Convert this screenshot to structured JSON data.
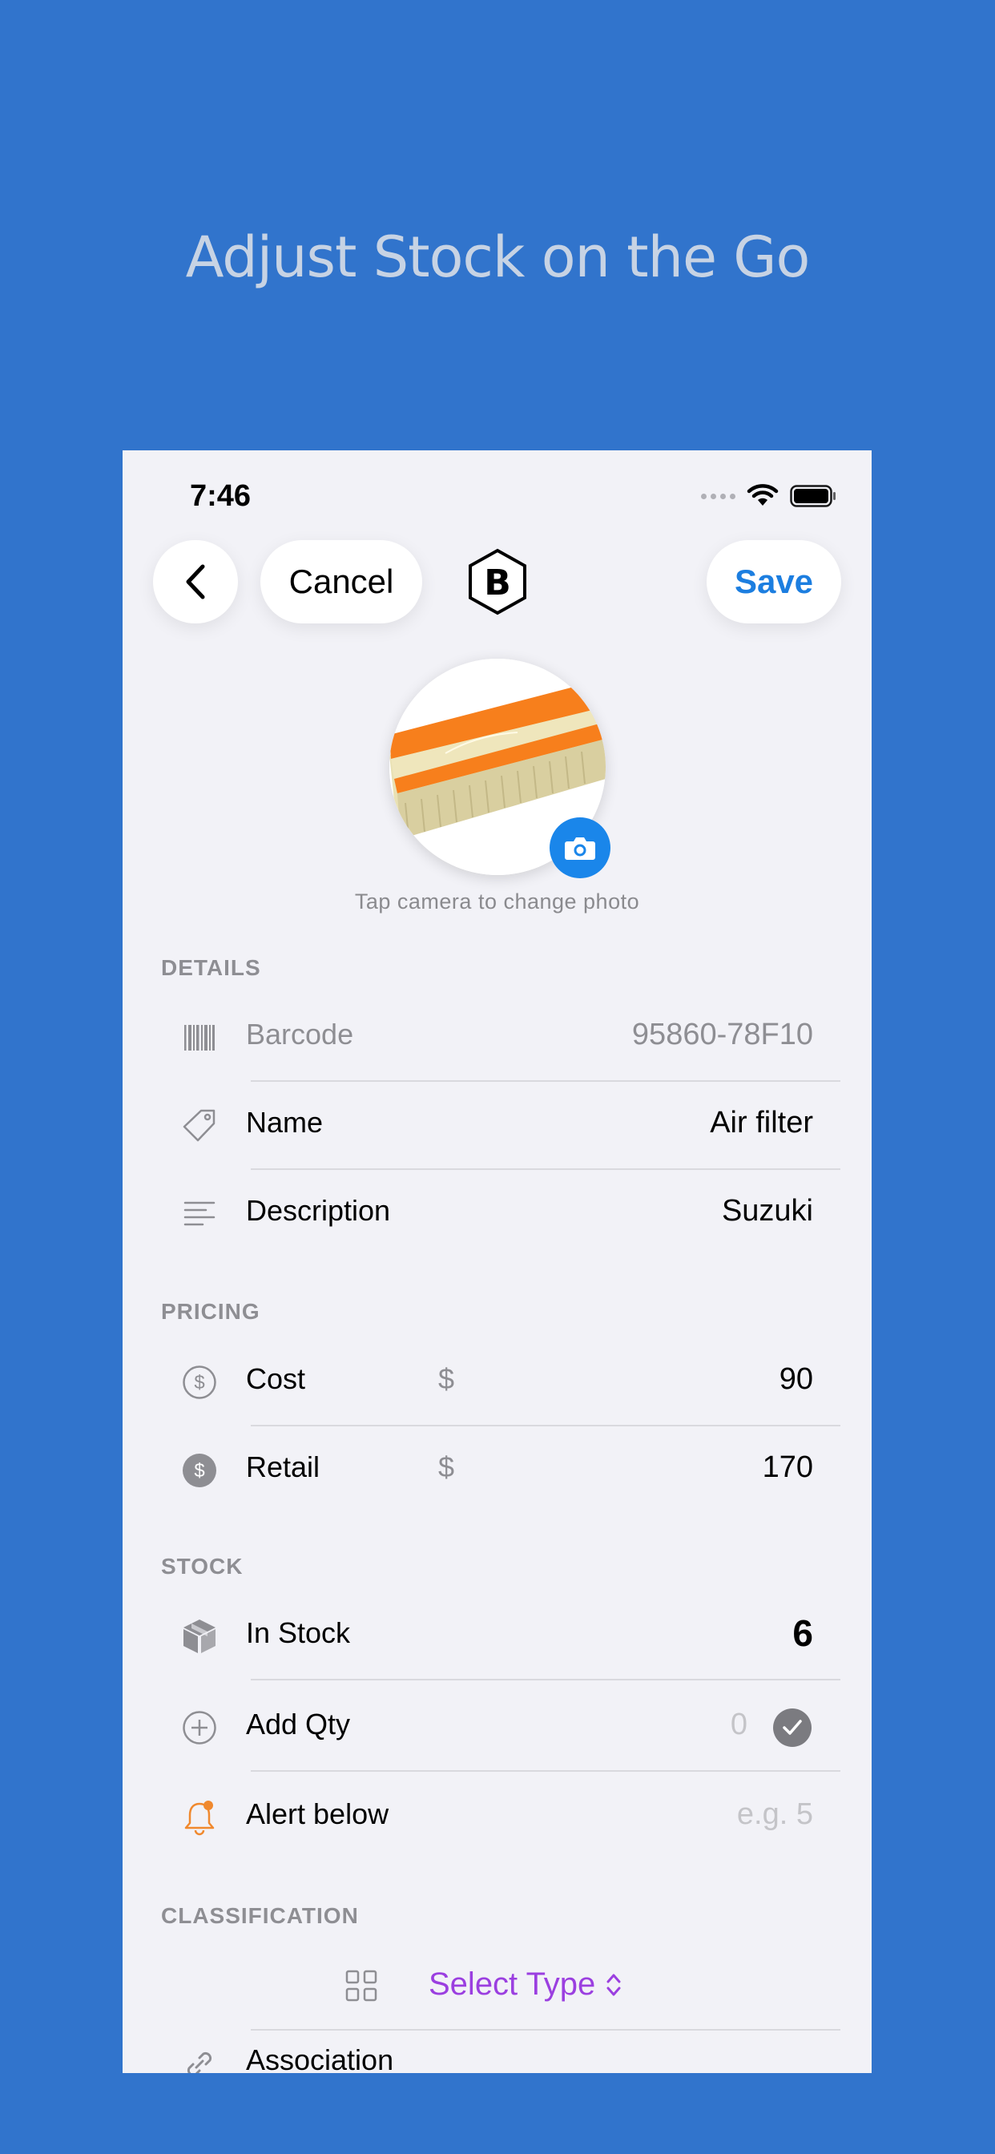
{
  "headline": "Adjust Stock on the Go",
  "status": {
    "time": "7:46"
  },
  "nav": {
    "cancel_label": "Cancel",
    "save_label": "Save",
    "logo_letter": "B"
  },
  "photo": {
    "hint": "Tap camera to change photo"
  },
  "details": {
    "header": "DETAILS",
    "barcode_label": "Barcode",
    "barcode_value": "95860-78F10",
    "name_label": "Name",
    "name_value": "Air filter",
    "description_label": "Description",
    "description_value": "Suzuki"
  },
  "pricing": {
    "header": "PRICING",
    "cost_label": "Cost",
    "cost_currency": "$",
    "cost_value": "90",
    "retail_label": "Retail",
    "retail_currency": "$",
    "retail_value": "170"
  },
  "stock": {
    "header": "STOCK",
    "in_stock_label": "In Stock",
    "in_stock_value": "6",
    "add_qty_label": "Add Qty",
    "add_qty_placeholder": "0",
    "alert_label": "Alert below",
    "alert_placeholder": "e.g. 5"
  },
  "classification": {
    "header": "CLASSIFICATION",
    "select_type_label": "Select Type",
    "association_label": "Association"
  },
  "colors": {
    "background": "#3174cc",
    "accent": "#1c7ee0",
    "purple": "#9b3fe0",
    "alert": "#f0892e"
  },
  "icons": [
    "back-chevron-icon",
    "logo-icon",
    "camera-icon",
    "barcode-icon",
    "tag-icon",
    "description-icon",
    "dollar-outline-icon",
    "dollar-filled-icon",
    "box-icon",
    "plus-circle-icon",
    "checkmark-icon",
    "bell-icon",
    "grid-icon",
    "updown-chevron-icon",
    "link-icon",
    "wifi-icon",
    "battery-icon"
  ]
}
